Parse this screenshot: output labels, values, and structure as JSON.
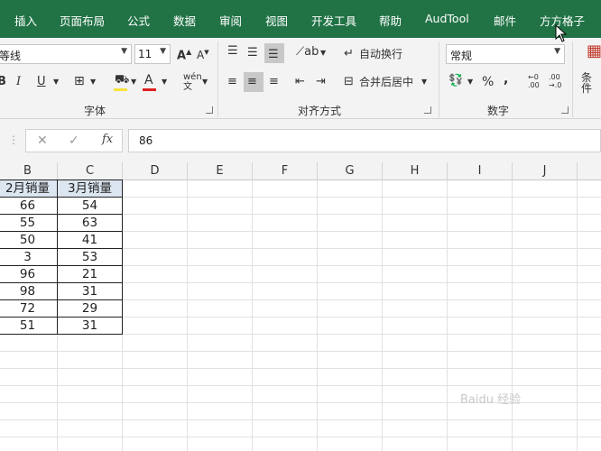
{
  "tabs": [
    "插入",
    "页面布局",
    "公式",
    "数据",
    "审阅",
    "视图",
    "开发工具",
    "帮助",
    "AudTool",
    "邮件",
    "方方格子"
  ],
  "ribbon": {
    "font_name": "等线",
    "font_size": "11",
    "font_group_label": "字体",
    "align_group_label": "对齐方式",
    "number_group_label": "数字",
    "wrap_text": "自动换行",
    "merge_center": "合并后居中",
    "number_format": "常规",
    "cond_label": "条件",
    "percent": "%",
    "comma": ",",
    "inc_decimal": ".00",
    "dec_decimal": ".0"
  },
  "formula_bar": {
    "value": "86"
  },
  "columns": [
    "B",
    "C",
    "D",
    "E",
    "F",
    "G",
    "H",
    "I",
    "J"
  ],
  "table": {
    "headers": [
      "2月销量",
      "3月销量"
    ],
    "rows": [
      [
        "66",
        "54"
      ],
      [
        "55",
        "63"
      ],
      [
        "50",
        "41"
      ],
      [
        "3",
        "53"
      ],
      [
        "96",
        "21"
      ],
      [
        "98",
        "31"
      ],
      [
        "72",
        "29"
      ],
      [
        "51",
        "31"
      ]
    ]
  },
  "colors": {
    "ribbon_tab_bg": "#217346",
    "header_fill": "#dce6f1"
  },
  "watermark": "Baidu 经验"
}
